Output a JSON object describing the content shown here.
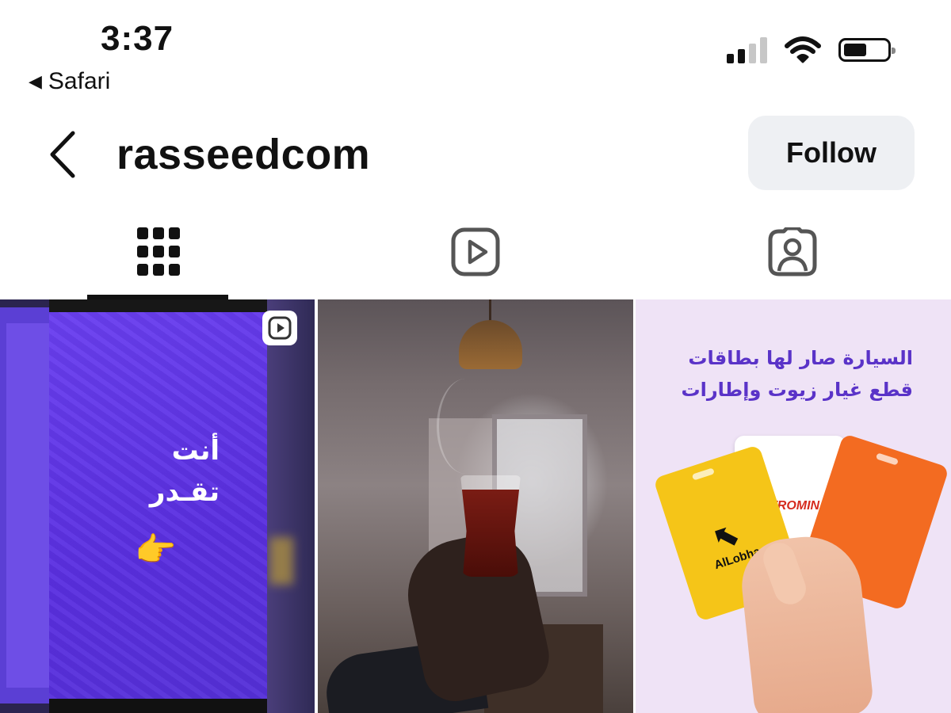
{
  "status_bar": {
    "time": "3:37",
    "back_app": "Safari",
    "back_app_icon": "left-triangle-icon",
    "signal_bars_active": 2,
    "icons": [
      "signal-icon",
      "wifi-icon",
      "battery-icon"
    ]
  },
  "header": {
    "username": "rasseedcom",
    "follow_label": "Follow",
    "back_icon": "chevron-left-icon"
  },
  "tabs": [
    {
      "name": "posts-grid",
      "icon": "grid-icon",
      "active": true
    },
    {
      "name": "reels",
      "icon": "reels-icon",
      "active": false
    },
    {
      "name": "tagged",
      "icon": "tagged-person-icon",
      "active": false
    }
  ],
  "posts": [
    {
      "type": "reel",
      "overlay_text_line1": "أنت",
      "overlay_text_line2": "تقـدر",
      "emoji": "👉"
    },
    {
      "type": "photo"
    },
    {
      "type": "photo",
      "headline_line1": "السيارة صار لها بطاقات",
      "headline_line2": "قطع غيار زيوت وإطارات",
      "card_label_1": "AlLobha",
      "card_label_2": "TROMIN"
    }
  ],
  "colors": {
    "follow_bg": "#eef0f3",
    "ad_headline": "#5a33c8",
    "reel_purple": "#5a2fe0"
  }
}
